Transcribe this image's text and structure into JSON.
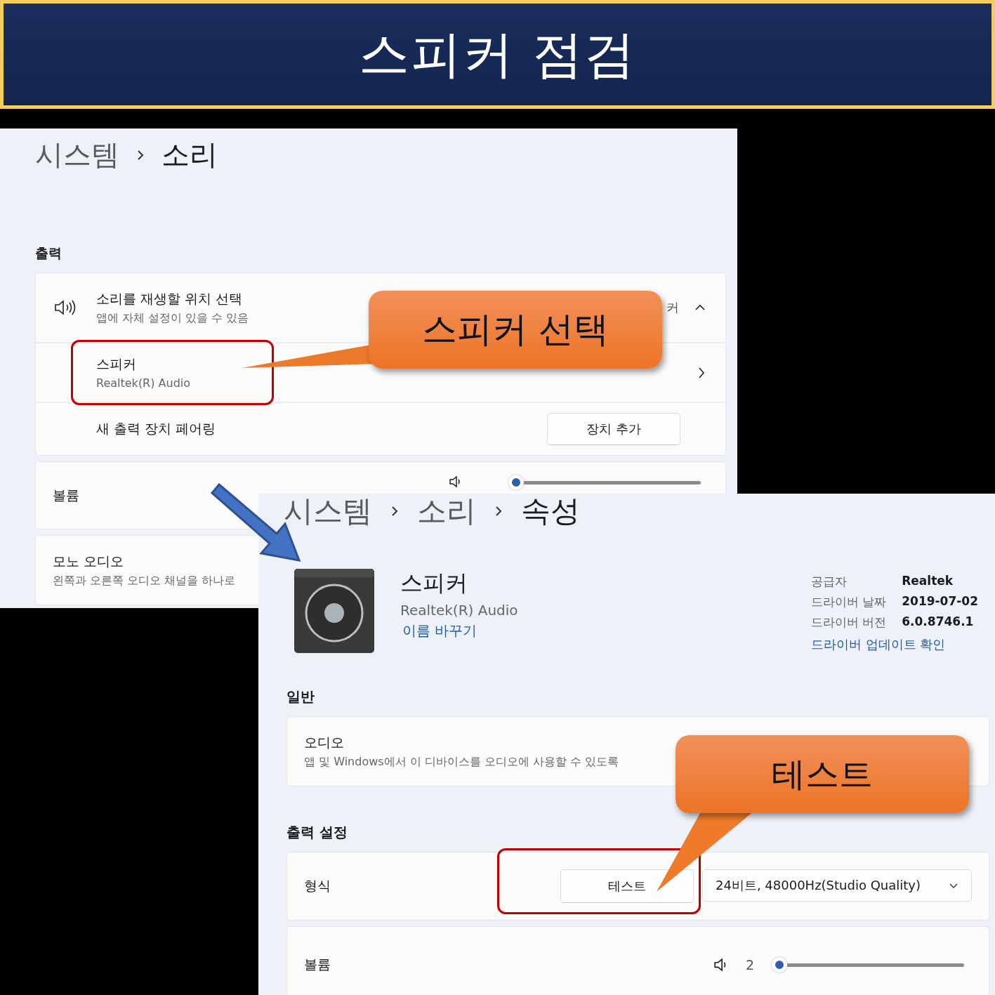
{
  "title": "스피커 점검",
  "sound_page": {
    "breadcrumb": [
      {
        "label": "시스템",
        "current": false
      },
      {
        "label": "소리",
        "current": true
      }
    ],
    "output_heading": "출력",
    "output_select": {
      "title": "소리를 재생할 위치 선택",
      "subtitle": "앱에 자체 설정이 있을 수 있음",
      "current": "커",
      "expanded": true
    },
    "devices": [
      {
        "name": "스피커",
        "detail": "Realtek(R) Audio"
      }
    ],
    "pair": {
      "label": "새 출력 장치 페어링",
      "button": "장치 추가"
    },
    "volume": {
      "label": "볼륨",
      "level": 0.02
    },
    "mono": {
      "title": "모노 오디오",
      "subtitle": "왼쪽과 오른쪽 오디오 채널을 하나로"
    }
  },
  "properties_page": {
    "breadcrumb": [
      {
        "label": "시스템",
        "current": false
      },
      {
        "label": "소리",
        "current": false
      },
      {
        "label": "속성",
        "current": true
      }
    ],
    "device": {
      "name": "스피커",
      "detail": "Realtek(R) Audio",
      "rename": "이름 바꾸기"
    },
    "info": [
      {
        "label": "공급자",
        "value": "Realtek"
      },
      {
        "label": "드라이버 날짜",
        "value": "2019-07-02"
      },
      {
        "label": "드라이버 버전",
        "value": "6.0.8746.1"
      }
    ],
    "update_link": "드라이버 업데이트 확인",
    "general_heading": "일반",
    "audio": {
      "title": "오디오",
      "subtitle": "앱 및 Windows에서 이 디바이스를 오디오에 사용할 수 있도록"
    },
    "output_heading": "출력 설정",
    "format": {
      "label": "형식",
      "test_button": "테스트",
      "value": "24비트, 48000Hz(Studio Quality)"
    },
    "volume": {
      "label": "볼륨",
      "reading": "2",
      "level": 0.02
    }
  },
  "callouts": [
    {
      "text": "스피커 선택"
    },
    {
      "text": "테스트"
    }
  ]
}
